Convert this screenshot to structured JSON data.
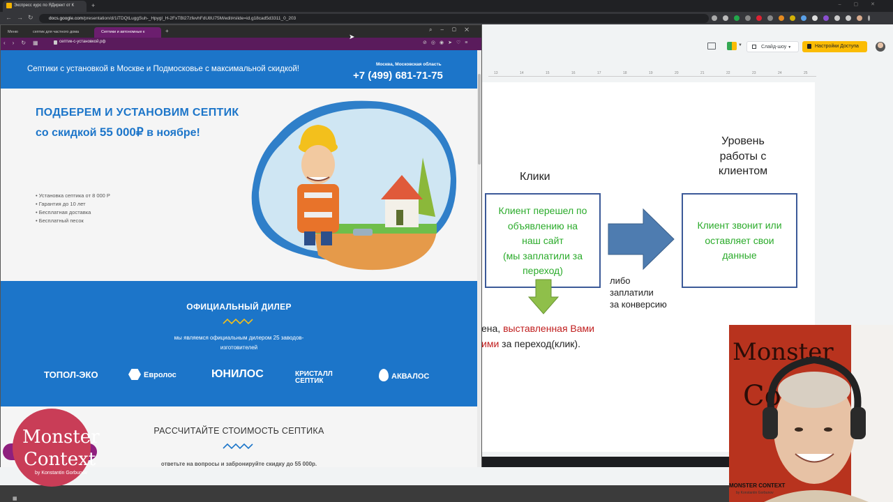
{
  "outer_browser": {
    "tab_title": "Экспресс курс по ЯДирект от К",
    "url_domain": "docs.google.com",
    "url_path": "/presentation/d/1iTDQtLuggSuh-_Hpygl_H-2FxTBl27zfevhFdU8U75M/edit#slide=id.g18cad5d3311_0_203"
  },
  "slides_app": {
    "slideshow_label": "Слайд-шоу",
    "share_label": "Настройки Доступа",
    "ruler_ticks": [
      "13",
      "14",
      "15",
      "16",
      "17",
      "18",
      "19",
      "20",
      "21",
      "22",
      "23",
      "24",
      "25"
    ],
    "slide": {
      "label_clicks": "Клики",
      "label_level": [
        "Уровень",
        "работы с",
        "клиентом"
      ],
      "box_left": [
        "Клиент перешел по",
        "объявлению на",
        "наш сайт",
        "(мы заплатили за",
        "переход)"
      ],
      "box_right": [
        "Клиент звонит или",
        "оставляет свои",
        "данные"
      ],
      "either_label": [
        "либо",
        "заплатили",
        "за конверсию"
      ],
      "bottom_line1_a": "ена, ",
      "bottom_line1_b": "выставленная Вами",
      "bottom_line2_a": "ими",
      "bottom_line2_b": " за переход(клик)."
    }
  },
  "inner_browser": {
    "tabs": [
      "Меню",
      "септик для частного дома",
      "Септики и автономные к"
    ],
    "url": "септик-с-установкой.рф"
  },
  "site": {
    "slogan": "Септики с установкой в Москве и Подмосковье с максимальной скидкой!",
    "city": "Москва, Московская область",
    "phone": "+7 (499) 681-71-75",
    "hero_line1": "ПОДБЕРЕМ И УСТАНОВИМ СЕПТИК",
    "hero_line2_pre": "со скидкой ",
    "hero_line2_amount": "55 000₽",
    "hero_line2_post": " в ноябре!",
    "bullets": [
      "Установка септика от 8 000 Р",
      "Гарантия до 10 лет",
      "Бесплатная доставка",
      "Бесплатный песок"
    ],
    "dealer_title": "ОФИЦИАЛЬНЫЙ ДИЛЕР",
    "dealer_sub1": "мы являемся официальным дилером 25 заводов-",
    "dealer_sub2": "изготовителей",
    "brands": [
      "ТОПОЛ-ЭКО",
      "Евролос",
      "ЮНИЛОС",
      "КРИСТАЛЛ СЕПТИК",
      "АКВАЛОС"
    ],
    "calc_title": "РАССЧИТАЙТЕ СТОИМОСТЬ СЕПТИКА",
    "calc_sub": "ответьте на вопросы и забронируйте скидку до 55 000р."
  },
  "overlay": {
    "logo_line1": "Monster",
    "logo_line2": "Context",
    "logo_line3": "by Konstantin Gorbunov",
    "webcam_brand": "MONSTER CONTEXT",
    "webcam_by": "by Konstantin Gorbunov"
  },
  "colors": {
    "site_blue": "#1c75c9",
    "slide_green": "#2bab2b",
    "slide_red": "#c01d1d",
    "share_yellow": "#fbbc04"
  }
}
